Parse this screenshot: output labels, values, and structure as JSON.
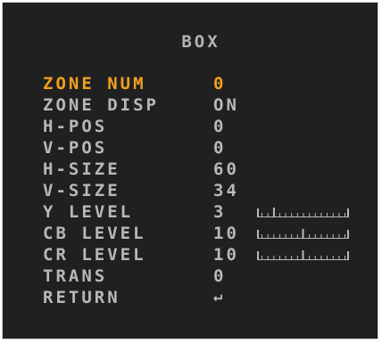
{
  "menu": {
    "title": "BOX",
    "accent_color": "#f0a020",
    "text_color": "#b8b8b8",
    "items": [
      {
        "label": "ZONE NUM",
        "value": "0",
        "selected": true
      },
      {
        "label": "ZONE DISP",
        "value": "ON"
      },
      {
        "label": "H-POS",
        "value": "0"
      },
      {
        "label": "V-POS",
        "value": "0"
      },
      {
        "label": "H-SIZE",
        "value": "60"
      },
      {
        "label": "V-SIZE",
        "value": "34"
      },
      {
        "label": "Y LEVEL",
        "value": "3",
        "slider_level": 0.15
      },
      {
        "label": "CB LEVEL",
        "value": "10",
        "slider_level": 0.5
      },
      {
        "label": "CR LEVEL",
        "value": "10",
        "slider_level": 0.5
      },
      {
        "label": "TRANS",
        "value": "0"
      },
      {
        "label": "RETURN",
        "value": "↵",
        "icon": "return-arrow-icon"
      }
    ]
  }
}
